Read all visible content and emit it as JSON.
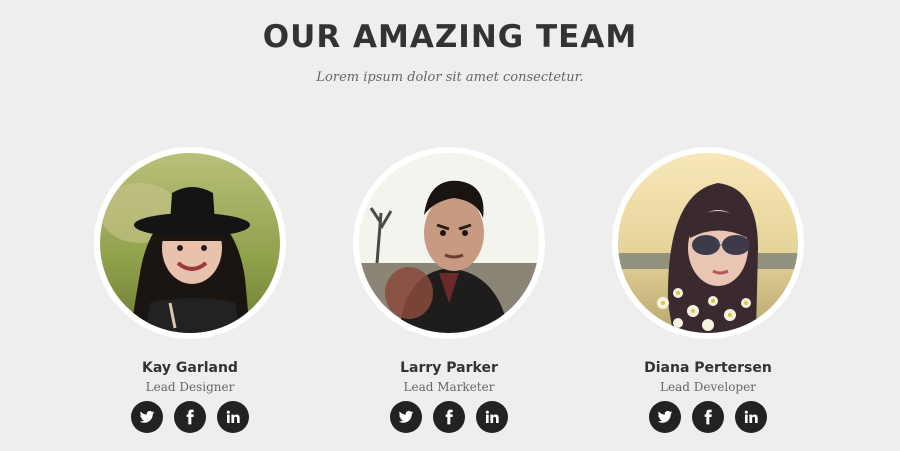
{
  "section": {
    "title": "OUR AMAZING TEAM",
    "subtitle": "Lorem ipsum dolor sit amet consectetur."
  },
  "team": [
    {
      "name": "Kay Garland",
      "role": "Lead Designer",
      "photo_icon": "portrait-woman-black-hat",
      "social": [
        "twitter-icon",
        "facebook-icon",
        "linkedin-icon"
      ]
    },
    {
      "name": "Larry Parker",
      "role": "Lead Marketer",
      "photo_icon": "portrait-man-leather-jacket",
      "social": [
        "twitter-icon",
        "facebook-icon",
        "linkedin-icon"
      ]
    },
    {
      "name": "Diana Pertersen",
      "role": "Lead Developer",
      "photo_icon": "portrait-woman-sunglasses-flowers",
      "social": [
        "twitter-icon",
        "facebook-icon",
        "linkedin-icon"
      ]
    }
  ],
  "colors": {
    "background": "#eeeeee",
    "heading": "#333333",
    "subtext": "#666666",
    "social_button": "#222222",
    "avatar_border": "#ffffff"
  }
}
